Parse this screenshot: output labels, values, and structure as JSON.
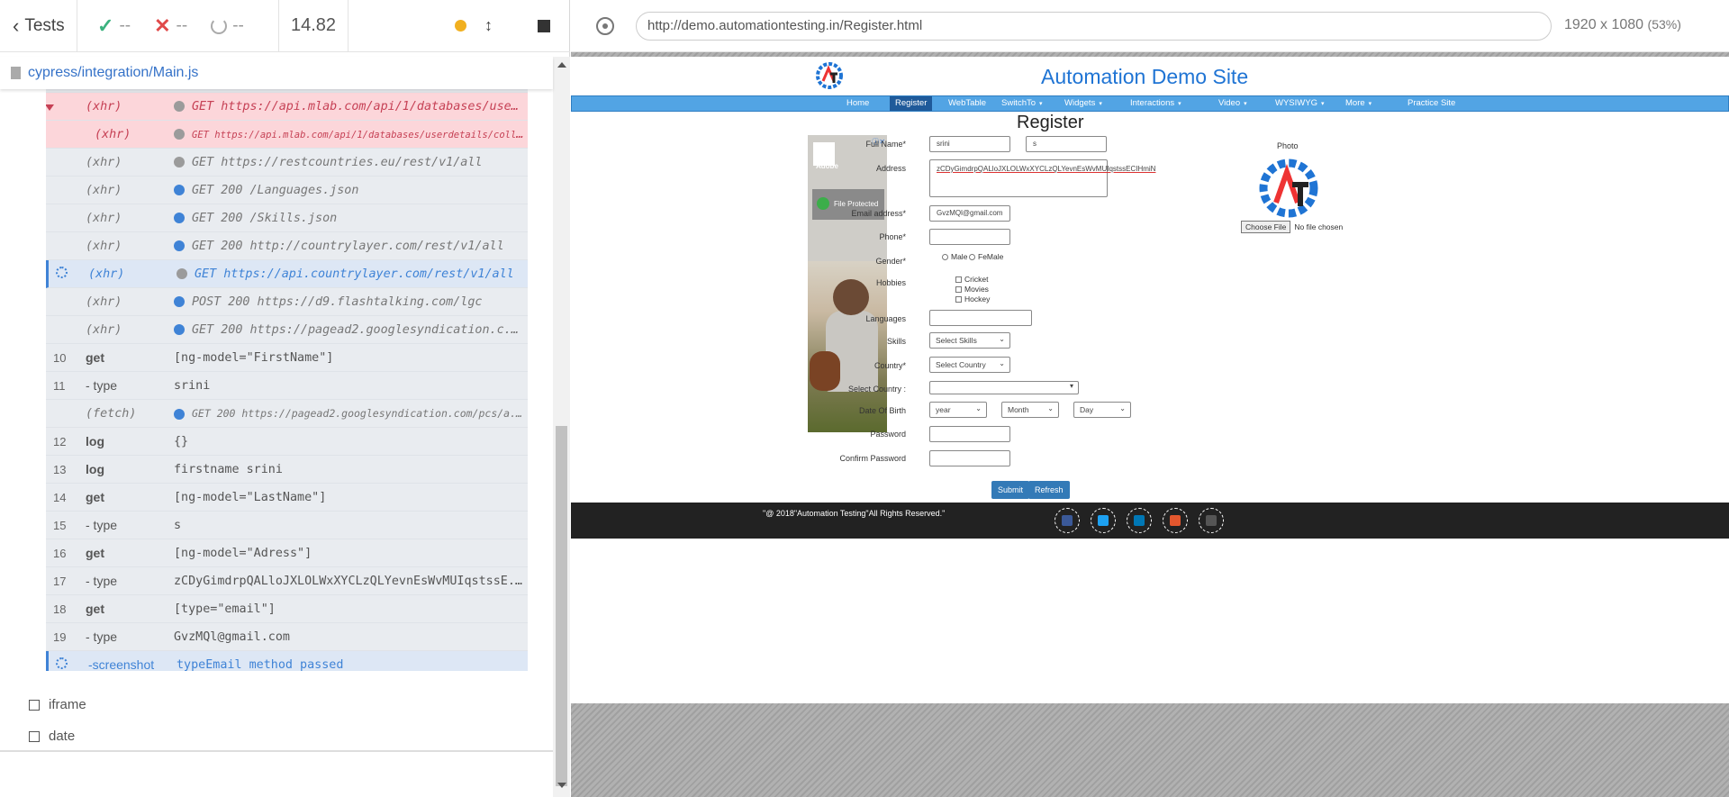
{
  "runner": {
    "back_label": "Tests",
    "passed": "--",
    "failed": "--",
    "pending": "--",
    "duration": "14.82",
    "spec_file": "cypress/integration/Main.js"
  },
  "command_log": [
    {
      "num": "",
      "cmd": "(xhr)",
      "msg": "GET 200 /languages.json",
      "kind": "xhr",
      "dot": "bl"
    },
    {
      "num": "",
      "cmd": "(xhr)",
      "msg": "GET https://api.mlab.com/api/1/databases/userdetails...",
      "kind": "err",
      "dot": "gr"
    },
    {
      "num": "",
      "cmd": "(xhr)",
      "msg": "GET https://api.mlab.com/api/1/databases/userdetails/colle...",
      "kind": "err-sub",
      "dot": "gr"
    },
    {
      "num": "",
      "cmd": "(xhr)",
      "msg": "GET https://restcountries.eu/rest/v1/all",
      "kind": "xhr",
      "dot": "gr"
    },
    {
      "num": "",
      "cmd": "(xhr)",
      "msg": "GET 200 /Languages.json",
      "kind": "xhr",
      "dot": "bl"
    },
    {
      "num": "",
      "cmd": "(xhr)",
      "msg": "GET 200 /Skills.json",
      "kind": "xhr",
      "dot": "bl"
    },
    {
      "num": "",
      "cmd": "(xhr)",
      "msg": "GET 200 http://countrylayer.com/rest/v1/all",
      "kind": "xhr",
      "dot": "bl"
    },
    {
      "num": "",
      "cmd": "(xhr)",
      "msg": "GET https://api.countrylayer.com/rest/v1/all",
      "kind": "sel",
      "dot": "gr"
    },
    {
      "num": "",
      "cmd": "(xhr)",
      "msg": "POST 200 https://d9.flashtalking.com/lgc",
      "kind": "xhr",
      "dot": "bl"
    },
    {
      "num": "",
      "cmd": "(xhr)",
      "msg": "GET 200 https://pagead2.googlesyndication.c...",
      "kind": "xhr",
      "dot": "bl"
    },
    {
      "num": "10",
      "cmd": "get",
      "msg": "[ng-model=\"FirstName\"]",
      "kind": "cmd"
    },
    {
      "num": "11",
      "cmd": "- type",
      "msg": "srini",
      "kind": "sub"
    },
    {
      "num": "",
      "cmd": "(fetch)",
      "msg": "GET 200 https://pagead2.googlesyndication.com/pcs/a...",
      "kind": "xhr-small",
      "dot": "bl"
    },
    {
      "num": "12",
      "cmd": "log",
      "msg": "{}",
      "kind": "cmd"
    },
    {
      "num": "13",
      "cmd": "log",
      "msg": "firstname srini",
      "kind": "cmd"
    },
    {
      "num": "14",
      "cmd": "get",
      "msg": "[ng-model=\"LastName\"]",
      "kind": "cmd"
    },
    {
      "num": "15",
      "cmd": "- type",
      "msg": "s",
      "kind": "sub"
    },
    {
      "num": "16",
      "cmd": "get",
      "msg": "[ng-model=\"Adress\"]",
      "kind": "cmd"
    },
    {
      "num": "17",
      "cmd": "- type",
      "msg": "zCDyGimdrpQALloJXLOLWxXYCLzQLYevnEsWvMUIqstssE...",
      "kind": "sub"
    },
    {
      "num": "18",
      "cmd": "get",
      "msg": "[type=\"email\"]",
      "kind": "cmd"
    },
    {
      "num": "19",
      "cmd": "- type",
      "msg": "GvzMQl@gmail.com",
      "kind": "sub"
    },
    {
      "num": "",
      "cmd": "-screenshot",
      "msg": "typeEmail method passed",
      "kind": "shot"
    }
  ],
  "other_tests": [
    "iframe",
    "date"
  ],
  "browser": {
    "url": "http://demo.automationtesting.in/Register.html",
    "viewport": "1920 x 1080",
    "zoom": "(53%)"
  },
  "site": {
    "title": "Automation Demo Site",
    "nav": [
      "Home",
      "Register",
      "WebTable",
      "SwitchTo",
      "Widgets",
      "Interactions",
      "Video",
      "WYSIWYG",
      "More",
      "Practice Site"
    ],
    "page_title": "Register",
    "ad": {
      "brand": "Adobe",
      "badge": "File Protected"
    },
    "labels": {
      "full_name": "Full Name*",
      "address": "Address",
      "email": "Email address*",
      "phone": "Phone*",
      "gender": "Gender*",
      "hobbies": "Hobbies",
      "languages": "Languages",
      "skills": "Skills",
      "country": "Country*",
      "select_country": "Select Country :",
      "dob": "Date Of Birth",
      "password": "Password",
      "confirm_password": "Confirm Password",
      "photo": "Photo"
    },
    "values": {
      "first_name": "srini",
      "last_name": "s",
      "address": "zCDyGimdrpQALloJXLOLWxXYCLzQLYevnEsWvMUIqstssECIHmiN",
      "email": "GvzMQl@gmail.com"
    },
    "gender_options": [
      "Male",
      "FeMale"
    ],
    "hobbies": [
      "Cricket",
      "Movies",
      "Hockey"
    ],
    "selects": {
      "skills": "Select Skills",
      "country": "Select Country",
      "year": "year",
      "month": "Month",
      "day": "Day"
    },
    "file": {
      "button": "Choose File",
      "status": "No file chosen"
    },
    "buttons": {
      "submit": "Submit",
      "refresh": "Refresh"
    },
    "footer": "\"@ 2018\"Automation Testing\"All Rights Reserved.\"",
    "social_colors": [
      "#3b5998",
      "#1da1f2",
      "#0077b5",
      "#e4572e",
      "#555555"
    ]
  }
}
